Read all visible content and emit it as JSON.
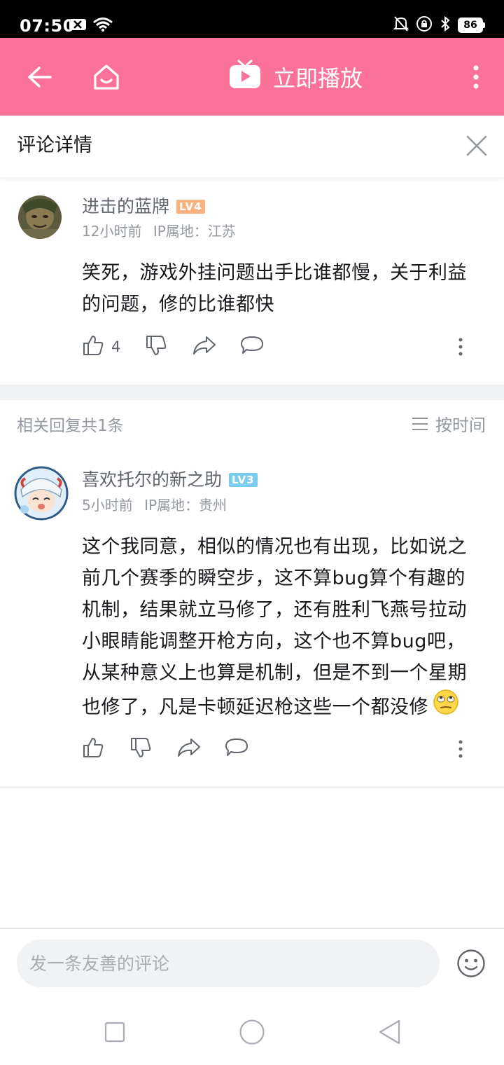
{
  "status_bar": {
    "time": "07:50",
    "battery": "86",
    "icons": [
      "close-box-icon",
      "wifi-icon",
      "mute-icon",
      "lock-rotation-icon",
      "bluetooth-icon",
      "battery-icon"
    ]
  },
  "nav": {
    "back_icon": "back-arrow-icon",
    "home_icon": "home-icon",
    "play_label": "立即播放",
    "play_icon": "tv-icon",
    "more_icon": "more-vertical-icon",
    "bg_color": "#fb7299"
  },
  "header": {
    "title": "评论详情",
    "close_icon": "close-icon"
  },
  "main_comment": {
    "username": "进击的蓝牌",
    "level": "LV4",
    "level_color": "#f9b37f",
    "time": "12小时前",
    "ip": "IP属地：江苏",
    "content_lines": [
      "笑死，游戏外挂问题出手比谁都慢，关于利益",
      "的问题，修的比谁都快"
    ],
    "likes": "4"
  },
  "replies_header": {
    "count": "相关回复共1条",
    "sort_label": "按时间"
  },
  "reply": {
    "username": "喜欢托尔的新之助",
    "level": "LV3",
    "level_color": "#7bcdef",
    "time": "5小时前",
    "ip": "IP属地：贵州",
    "content_lines": [
      "这个我同意，相似的情况也有出现，比如说之",
      "前几个赛季的瞬空步，这不算bug算个有趣的",
      "机制，结果就立马修了，还有胜利飞燕号拉动",
      "小眼睛能调整开枪方向，这个也不算bug吧，",
      "从某种意义上也算是机制，但是不到一个星期",
      "也修了，凡是卡顿延迟枪这些一个都没修"
    ],
    "trailing_emoji": "🙄"
  },
  "comment_input": {
    "placeholder": "发一条友善的评论"
  }
}
